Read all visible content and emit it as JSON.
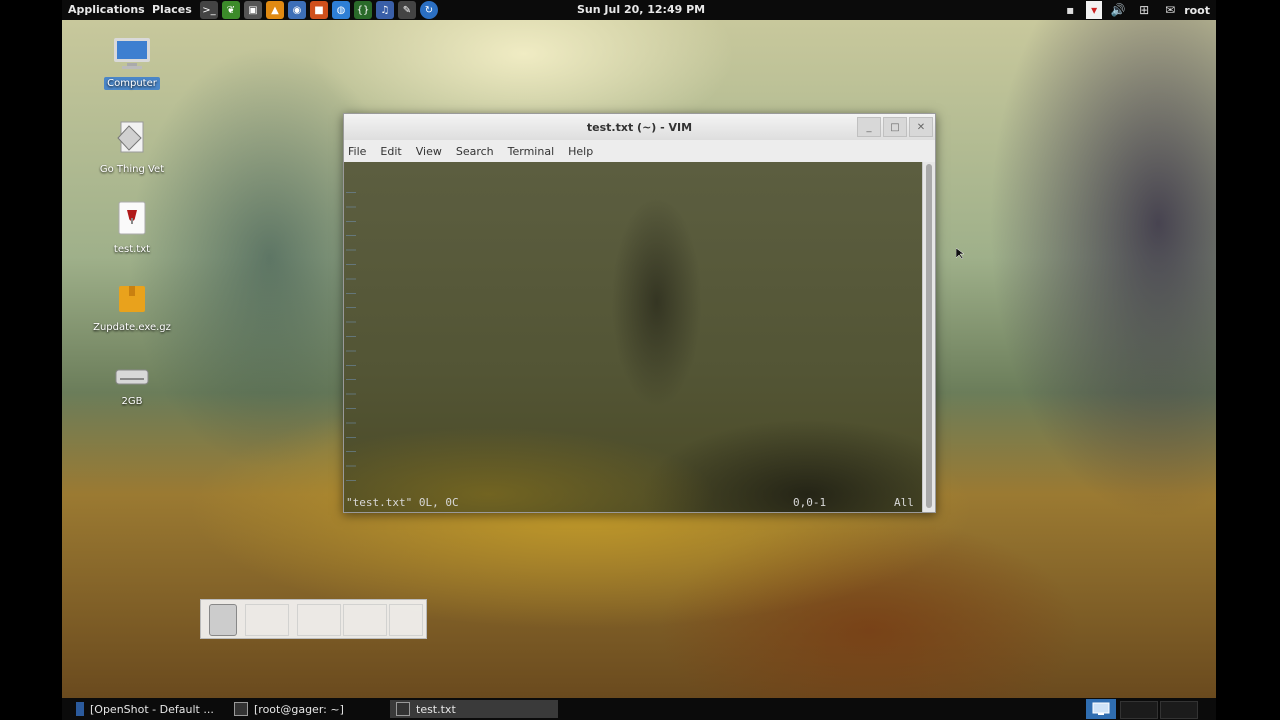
{
  "top_panel": {
    "applications_label": "Applications",
    "places_label": "Places",
    "clock": "Sun Jul 20, 12:49 PM",
    "user": "root",
    "launchers": [
      "terminal-icon",
      "leaf-icon",
      "window-icon",
      "vlc-cone-icon",
      "browser-icon",
      "package-icon",
      "chrome-icon",
      "code-braces-icon",
      "music-note-icon",
      "pen-tool-icon",
      "update-icon"
    ]
  },
  "desktop": {
    "icons": [
      {
        "label": "Computer",
        "icon": "computer-icon"
      },
      {
        "label": "Go Thing Vet",
        "icon": "script-file-icon"
      },
      {
        "label": "test.txt",
        "icon": "text-file-icon"
      },
      {
        "label": "Zupdate.exe.gz",
        "icon": "archive-icon"
      },
      {
        "label": "2GB",
        "icon": "drive-icon"
      }
    ]
  },
  "vim_window": {
    "title": "test.txt (~) - VIM",
    "menu": [
      "File",
      "Edit",
      "View",
      "Search",
      "Terminal",
      "Help"
    ],
    "status": {
      "file_info": "\"test.txt\" 0L, 0C",
      "position": "0,0-1",
      "scroll": "All"
    }
  },
  "bottom_panel": {
    "tasks": [
      {
        "label": "[OpenShot - Default ..."
      },
      {
        "label": "[root@gager: ~]"
      },
      {
        "label": "test.txt"
      }
    ]
  },
  "colors": {
    "panel_bg": "#0b0b0b",
    "selection_blue": "#4a86c8"
  }
}
